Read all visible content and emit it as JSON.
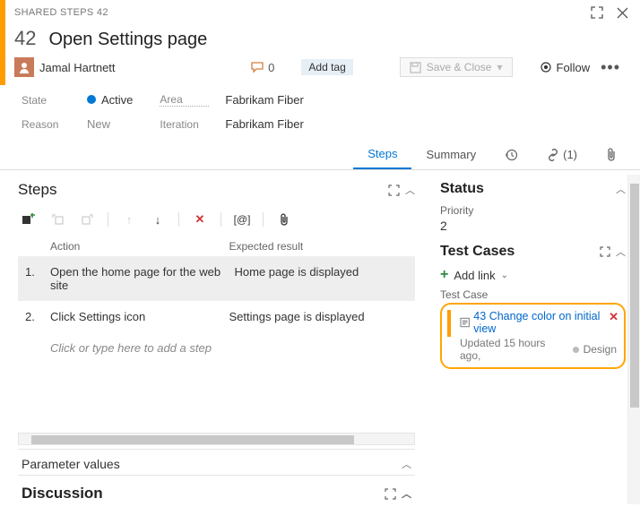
{
  "header": {
    "type_label": "SHARED STEPS 42",
    "id": "42",
    "title": "Open Settings page",
    "assigned_to": "Jamal Hartnett",
    "discussion_count": "0",
    "add_tag": "Add tag",
    "save_close": "Save & Close",
    "follow": "Follow"
  },
  "fields": {
    "state_label": "State",
    "state_value": "Active",
    "reason_label": "Reason",
    "reason_value": "New",
    "area_label": "Area",
    "area_value": "Fabrikam Fiber",
    "iteration_label": "Iteration",
    "iteration_value": "Fabrikam Fiber"
  },
  "tabs": {
    "steps": "Steps",
    "summary": "Summary",
    "links_count": "(1)"
  },
  "steps": {
    "title": "Steps",
    "col_action": "Action",
    "col_expected": "Expected result",
    "rows": [
      {
        "idx": "1.",
        "action": "Open the home page for the web site",
        "expected": "Home page is displayed"
      },
      {
        "idx": "2.",
        "action": "Click Settings icon",
        "expected": "Settings page is displayed"
      }
    ],
    "add_hint": "Click or type here to add a step",
    "param_values": "Parameter values",
    "param_at": "[@]"
  },
  "discussion": {
    "title": "Discussion"
  },
  "status": {
    "title": "Status",
    "priority_label": "Priority",
    "priority_value": "2"
  },
  "testcases": {
    "title": "Test Cases",
    "add_link": "Add link",
    "section_label": "Test Case",
    "linked": {
      "id": "43",
      "title": "Change color on initial view",
      "updated": "Updated 15 hours ago,",
      "state": "Design"
    }
  }
}
